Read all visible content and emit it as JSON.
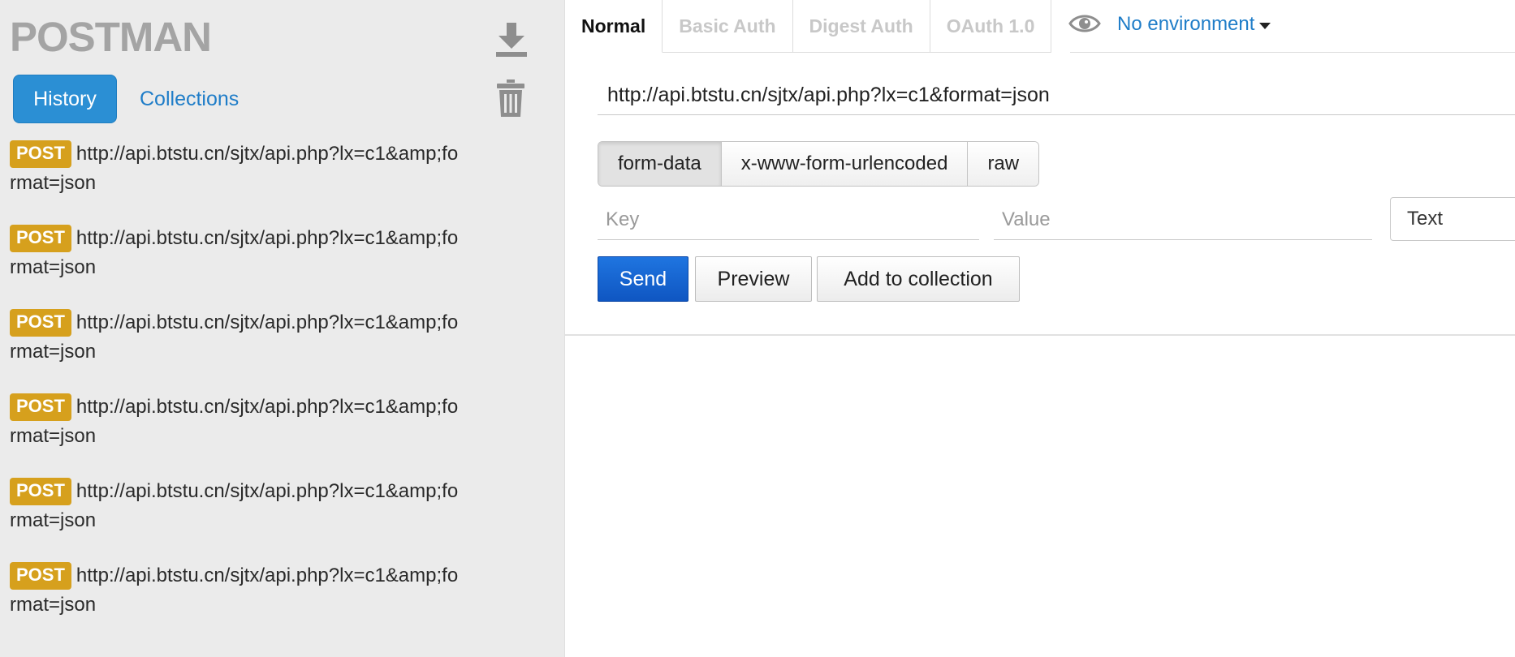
{
  "sidebar": {
    "logo": "POSTMAN",
    "tabs": {
      "history": "History",
      "collections": "Collections"
    },
    "history": [
      {
        "method": "POST",
        "url": "http://api.btstu.cn/sjtx/api.php?lx=c1&amp;format=json"
      },
      {
        "method": "POST",
        "url": "http://api.btstu.cn/sjtx/api.php?lx=c1&amp;format=json"
      },
      {
        "method": "POST",
        "url": "http://api.btstu.cn/sjtx/api.php?lx=c1&amp;format=json"
      },
      {
        "method": "POST",
        "url": "http://api.btstu.cn/sjtx/api.php?lx=c1&amp;format=json"
      },
      {
        "method": "POST",
        "url": "http://api.btstu.cn/sjtx/api.php?lx=c1&amp;format=json"
      },
      {
        "method": "POST",
        "url": "http://api.btstu.cn/sjtx/api.php?lx=c1&amp;format=json"
      }
    ],
    "icons": {
      "download": "download-icon",
      "trash": "trash-icon"
    }
  },
  "main": {
    "auth_tabs": [
      {
        "label": "Normal",
        "active": true
      },
      {
        "label": "Basic Auth",
        "active": false
      },
      {
        "label": "Digest Auth",
        "active": false
      },
      {
        "label": "OAuth 1.0",
        "active": false
      }
    ],
    "environment": "No environment",
    "url": "http://api.btstu.cn/sjtx/api.php?lx=c1&format=json",
    "body_modes": [
      {
        "label": "form-data",
        "active": true
      },
      {
        "label": "x-www-form-urlencoded",
        "active": false
      },
      {
        "label": "raw",
        "active": false
      }
    ],
    "key_placeholder": "Key",
    "value_placeholder": "Value",
    "type_value": "Text",
    "buttons": {
      "send": "Send",
      "preview": "Preview",
      "add_to_collection": "Add to collection"
    }
  },
  "colors": {
    "sidebar_bg": "#ebebeb",
    "logo": "#a4a4a4",
    "accent_blue": "#2b8fd4",
    "link_blue": "#1f7dc8",
    "post_badge": "#d6a01d",
    "send_blue": "#1464d2"
  }
}
